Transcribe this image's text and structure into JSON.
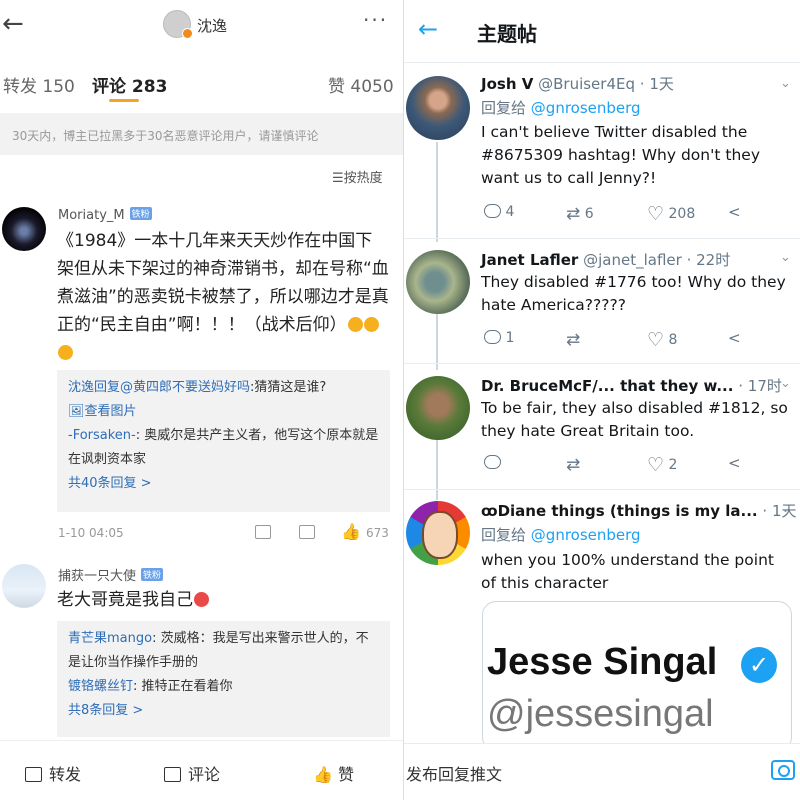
{
  "weibo": {
    "back_icon": "←",
    "author": "沈逸",
    "more_icon": "···",
    "tabs": [
      {
        "label": "转发 150"
      },
      {
        "label": "评论 283"
      },
      {
        "label": "赞 4050"
      }
    ],
    "notice": "30天内，博主已拉黑多于30名恶意评论用户，请谨慎评论",
    "sort_label": "☰按热度",
    "comments": [
      {
        "user": "Moriaty_M",
        "badge": "铁粉",
        "text": "《1984》一本十几年来天天炒作在中国下架但从未下架过的神奇滞销书，却在号称“血煮滋油”的恶卖锐卡被禁了，所以哪边才是真正的“民主自由”啊！！！（战术后仰）",
        "replies": [
          {
            "user": "沈逸回复@黄四郎不要送妈好吗",
            "text": ":猜猜这是谁?"
          },
          {
            "user": "",
            "text": "🖼查看图片"
          },
          {
            "user": "-Forsaken-",
            "text": ": 奥威尔是共产主义者，他写这个原本就是在讽刺资本家"
          }
        ],
        "more_replies": "共40条回复 >",
        "time": "1-10 04:05",
        "likes": "673"
      },
      {
        "user": "捕获一只大使",
        "badge": "铁粉",
        "text": "老大哥竟是我自己",
        "replies": [
          {
            "user": "青芒果mango",
            "text": ": 茨威格：我是写出来警示世人的，不是让你当作操作手册的"
          },
          {
            "user": "镀铬螺丝钉",
            "text": ": 推特正在看着你"
          }
        ],
        "more_replies": "共8条回复 >"
      }
    ],
    "bottom": {
      "repost": "转发",
      "comment": "评论",
      "like": "赞"
    }
  },
  "twitter": {
    "back_icon": "←",
    "title": "主题帖",
    "tweets": [
      {
        "name": "Josh V",
        "handle": "@Bruiser4Eq",
        "time": "· 1天",
        "reply_prefix": "回复给",
        "reply_to": "@gnrosenberg",
        "text": "I can't believe Twitter disabled the #8675309 hashtag! Why don't they want us to call Jenny?!",
        "replies": "4",
        "retweets": "6",
        "likes": "208"
      },
      {
        "name": "Janet Lafler",
        "handle": "@janet_lafler",
        "time": "· 22时",
        "text": "They disabled #1776 too! Why do they hate America?????",
        "replies": "1",
        "retweets": "",
        "likes": "8"
      },
      {
        "name": "Dr. BruceMcF/... that they w...",
        "handle": "",
        "time": "· 17时",
        "text": "To be fair, they also disabled #1812, so they hate Great Britain too.",
        "replies": "",
        "retweets": "",
        "likes": "2"
      },
      {
        "name": "ꝏDiane things (things is my la...",
        "handle": "",
        "time": "· 1天",
        "reply_prefix": "回复给",
        "reply_to": "@gnrosenberg",
        "text": "when you 100% understand the point of this character",
        "quote_name": "Jesse Singal",
        "quote_handle": "@jessesingal"
      }
    ],
    "compose_placeholder": "发布回复推文"
  }
}
